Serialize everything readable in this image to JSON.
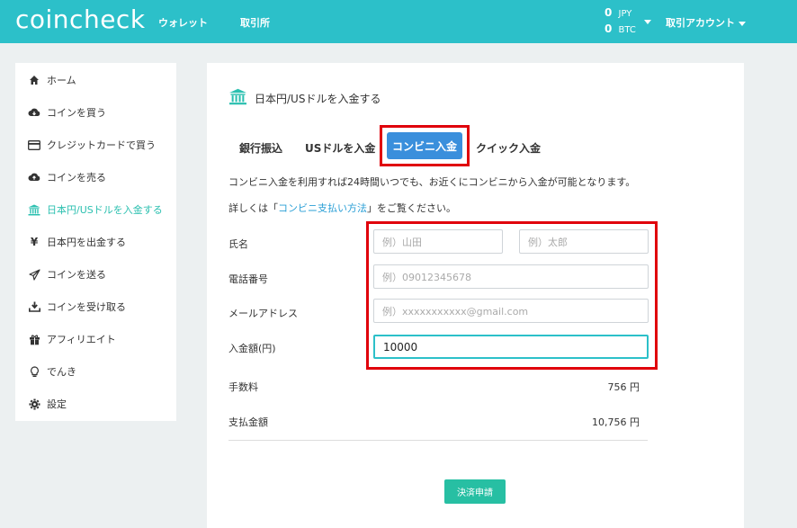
{
  "header": {
    "logo": "coincheck",
    "nav": [
      "ウォレット",
      "取引所"
    ],
    "balances": [
      {
        "amount": "0",
        "currency": "JPY"
      },
      {
        "amount": "0",
        "currency": "BTC"
      }
    ],
    "account_label": "取引アカウント"
  },
  "sidebar": {
    "items": [
      {
        "label": "ホーム",
        "icon": "home-icon"
      },
      {
        "label": "コインを買う",
        "icon": "cloud-download-icon"
      },
      {
        "label": "クレジットカードで買う",
        "icon": "credit-card-icon"
      },
      {
        "label": "コインを売る",
        "icon": "cloud-upload-icon"
      },
      {
        "label": "日本円/USドルを入金する",
        "icon": "bank-icon",
        "active": true
      },
      {
        "label": "日本円を出金する",
        "icon": "yen-icon"
      },
      {
        "label": "コインを送る",
        "icon": "send-icon"
      },
      {
        "label": "コインを受け取る",
        "icon": "download-icon"
      },
      {
        "label": "アフィリエイト",
        "icon": "gift-icon"
      },
      {
        "label": "でんき",
        "icon": "lightbulb-icon"
      },
      {
        "label": "設定",
        "icon": "gear-icon"
      }
    ]
  },
  "main": {
    "title": "日本円/USドルを入金する",
    "tabs": [
      "銀行振込",
      "USドルを入金",
      "コンビニ入金",
      "クイック入金"
    ],
    "active_tab": "コンビニ入金",
    "description": "コンビニ入金を利用すれば24時間いつでも、お近くにコンビニから入金が可能となります。",
    "detail_prefix": "詳しくは「",
    "detail_link": "コンビニ支払い方法",
    "detail_suffix": "」をご覧ください。",
    "form": {
      "name_label": "氏名",
      "last_name_placeholder": "例）山田",
      "first_name_placeholder": "例）太郎",
      "phone_label": "電話番号",
      "phone_placeholder": "例）09012345678",
      "email_label": "メールアドレス",
      "email_placeholder": "例）xxxxxxxxxxx@gmail.com",
      "amount_label": "入金額(円)",
      "amount_value": "10000"
    },
    "fee_label": "手数料",
    "fee_value": "756 円",
    "total_label": "支払金額",
    "total_value": "10,756 円",
    "submit_label": "決済申請"
  },
  "colors": {
    "header": "#2cc0c9",
    "active_tab": "#3a8fdc",
    "submit": "#27bfa3",
    "highlight": "#e0000b",
    "active_sidebar": "#2cc0b0"
  }
}
